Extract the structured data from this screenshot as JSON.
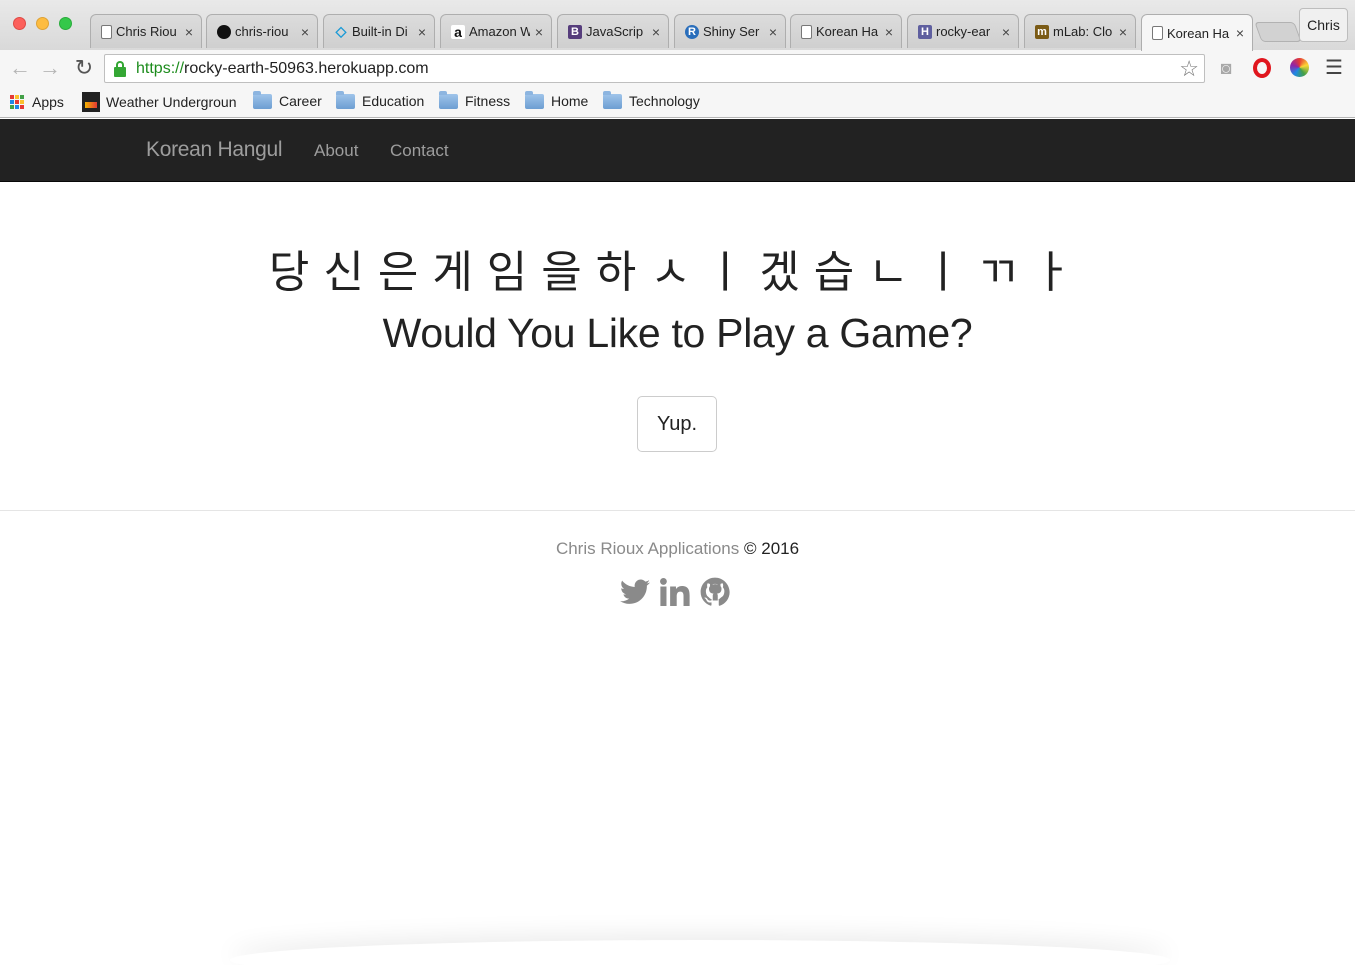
{
  "browser": {
    "tabs": [
      {
        "title": "Chris Riou",
        "favicon": "page-icon"
      },
      {
        "title": "chris-riou",
        "favicon": "github-icon"
      },
      {
        "title": "Built-in Di",
        "favicon": "code-icon"
      },
      {
        "title": "Amazon W",
        "favicon": "amazon-icon"
      },
      {
        "title": "JavaScrip",
        "favicon": "bootstrap-icon"
      },
      {
        "title": "Shiny Ser",
        "favicon": "r-icon"
      },
      {
        "title": "Korean Ha",
        "favicon": "page-icon"
      },
      {
        "title": "rocky-ear",
        "favicon": "heroku-icon"
      },
      {
        "title": "mLab: Clo",
        "favicon": "mlab-icon"
      },
      {
        "title": "Korean Ha",
        "favicon": "page-icon"
      }
    ],
    "tab_close": "×",
    "profile_name": "Chris",
    "url_scheme": "https://",
    "url_host": "rocky-earth-50963.herokuapp.com",
    "bookmarks": {
      "apps": "Apps",
      "weather": "Weather Undergroun",
      "folders": [
        "Career",
        "Education",
        "Fitness",
        "Home",
        "Technology"
      ]
    }
  },
  "navbar": {
    "brand": "Korean Hangul",
    "links": [
      "About",
      "Contact"
    ]
  },
  "main": {
    "korean_title": "당신은게임을하ㅅㅣ겠습ㄴㅣㄲㅏ",
    "headline": "Would You Like to Play a Game?",
    "button_label": "Yup."
  },
  "footer": {
    "name": "Chris Rioux Applications",
    "copyright": "© 2016",
    "socials": [
      "twitter-icon",
      "linkedin-icon",
      "github-icon"
    ]
  },
  "colors": {
    "navbar_bg": "#222222",
    "nav_text": "#9d9d9d",
    "secure_green": "#1d8c1d"
  }
}
